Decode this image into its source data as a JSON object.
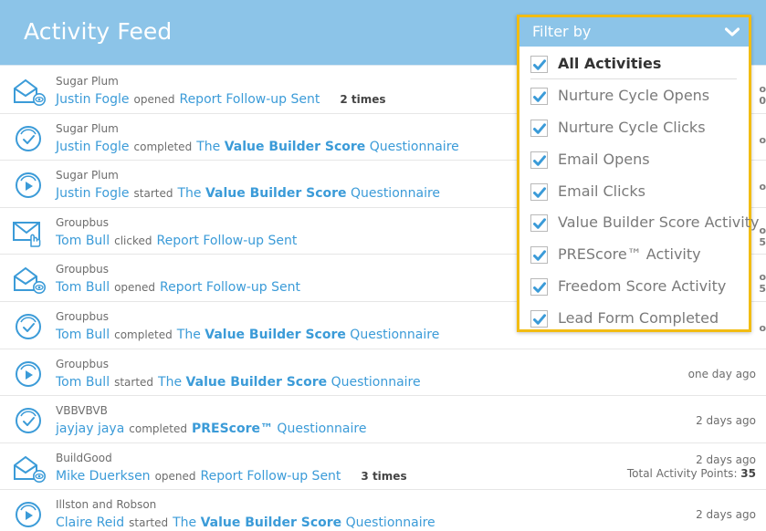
{
  "header": {
    "title": "Activity Feed"
  },
  "colors": {
    "accent": "#3b9bd8",
    "header": "#8cc4e8",
    "highlight": "#f2bc12"
  },
  "feed": {
    "rows": [
      {
        "icon": "email-open-icon",
        "company": "Sugar Plum",
        "person": "Justin Fogle",
        "verb": "opened",
        "activity_plain": "Report Follow-up Sent",
        "activity_bold": "",
        "activity_rest": "",
        "count": "2 times",
        "time": "",
        "points_label": "",
        "points_value": "",
        "edge_fragment": "o\n0"
      },
      {
        "icon": "completed-check-icon",
        "company": "Sugar Plum",
        "person": "Justin Fogle",
        "verb": "completed",
        "activity_plain": "The ",
        "activity_bold": "Value Builder Score",
        "activity_rest": " Questionnaire",
        "count": "",
        "time": "",
        "points_label": "",
        "points_value": "",
        "edge_fragment": "o"
      },
      {
        "icon": "started-play-icon",
        "company": "Sugar Plum",
        "person": "Justin Fogle",
        "verb": "started",
        "activity_plain": "The ",
        "activity_bold": "Value Builder Score",
        "activity_rest": " Questionnaire",
        "count": "",
        "time": "",
        "points_label": "",
        "points_value": "",
        "edge_fragment": "o"
      },
      {
        "icon": "email-click-icon",
        "company": "Groupbus",
        "person": "Tom Bull",
        "verb": "clicked",
        "activity_plain": "Report Follow-up Sent",
        "activity_bold": "",
        "activity_rest": "",
        "count": "",
        "time": "",
        "points_label": "",
        "points_value": "",
        "edge_fragment": "o\n5"
      },
      {
        "icon": "email-open-icon",
        "company": "Groupbus",
        "person": "Tom Bull",
        "verb": "opened",
        "activity_plain": "Report Follow-up Sent",
        "activity_bold": "",
        "activity_rest": "",
        "count": "",
        "time": "",
        "points_label": "",
        "points_value": "",
        "edge_fragment": "o\n5"
      },
      {
        "icon": "completed-check-icon",
        "company": "Groupbus",
        "person": "Tom Bull",
        "verb": "completed",
        "activity_plain": "The ",
        "activity_bold": "Value Builder Score",
        "activity_rest": " Questionnaire",
        "count": "",
        "time": "",
        "points_label": "",
        "points_value": "",
        "edge_fragment": "o"
      },
      {
        "icon": "started-play-icon",
        "company": "Groupbus",
        "person": "Tom Bull",
        "verb": "started",
        "activity_plain": "The ",
        "activity_bold": "Value Builder Score",
        "activity_rest": " Questionnaire",
        "count": "",
        "time": "one day ago",
        "points_label": "",
        "points_value": "",
        "edge_fragment": ""
      },
      {
        "icon": "completed-check-icon",
        "company": "VBBVBVB",
        "person": "jayjay jaya",
        "verb": "completed",
        "activity_plain": "",
        "activity_bold": "PREScore™",
        "activity_rest": " Questionnaire",
        "count": "",
        "time": "2 days ago",
        "points_label": "",
        "points_value": "",
        "edge_fragment": ""
      },
      {
        "icon": "email-open-icon",
        "company": "BuildGood",
        "person": "Mike Duerksen",
        "verb": "opened",
        "activity_plain": "Report Follow-up Sent",
        "activity_bold": "",
        "activity_rest": "",
        "count": "3 times",
        "time": "2 days ago",
        "points_label": "Total Activity Points: ",
        "points_value": "35",
        "edge_fragment": ""
      },
      {
        "icon": "started-play-icon",
        "company": "Illston and Robson",
        "person": "Claire Reid",
        "verb": "started",
        "activity_plain": "The ",
        "activity_bold": "Value Builder Score",
        "activity_rest": " Questionnaire",
        "count": "",
        "time": "2 days ago",
        "points_label": "",
        "points_value": "",
        "edge_fragment": ""
      }
    ]
  },
  "filter": {
    "label": "Filter by",
    "chevron_icon": "chevron-down-icon",
    "options": [
      {
        "label": "All Activities",
        "checked": true
      },
      {
        "label": "Nurture Cycle Opens",
        "checked": true
      },
      {
        "label": "Nurture Cycle Clicks",
        "checked": true
      },
      {
        "label": "Email Opens",
        "checked": true
      },
      {
        "label": "Email Clicks",
        "checked": true
      },
      {
        "label": "Value Builder Score Activity",
        "checked": true
      },
      {
        "label": "PREScore™ Activity",
        "checked": true
      },
      {
        "label": "Freedom Score Activity",
        "checked": true
      },
      {
        "label": "Lead Form Completed",
        "checked": true
      }
    ]
  }
}
